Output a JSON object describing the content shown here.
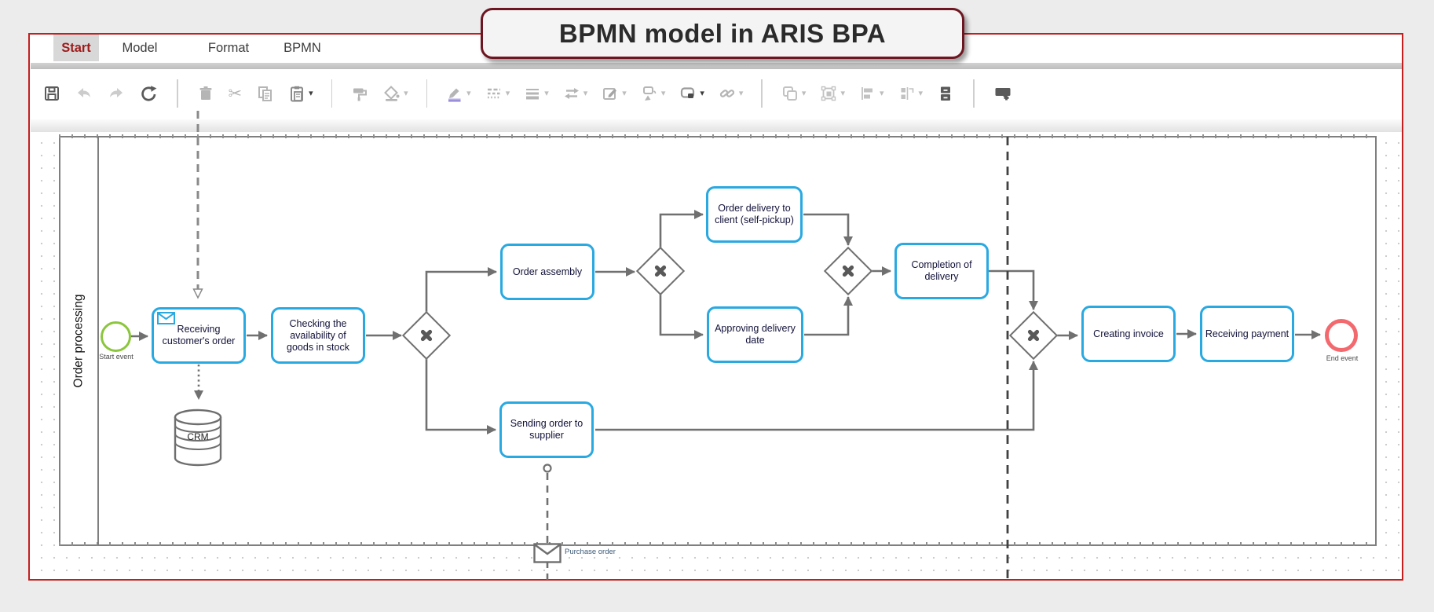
{
  "banner": {
    "title": "BPMN model in ARIS BPA"
  },
  "menu": {
    "items": [
      {
        "label": "Start",
        "active": true
      },
      {
        "label": "Model",
        "active": false
      },
      {
        "label": "Format",
        "active": false
      },
      {
        "label": "BPMN",
        "active": false
      }
    ]
  },
  "toolbar": {
    "buttons": [
      {
        "name": "save",
        "enabled": true,
        "dropdown": false
      },
      {
        "name": "undo",
        "enabled": false,
        "dropdown": false
      },
      {
        "name": "redo",
        "enabled": false,
        "dropdown": false
      },
      {
        "name": "refresh",
        "enabled": true,
        "dropdown": false
      },
      {
        "name": "delete",
        "enabled": false,
        "dropdown": false
      },
      {
        "name": "cut",
        "enabled": false,
        "dropdown": false
      },
      {
        "name": "copy",
        "enabled": false,
        "dropdown": false
      },
      {
        "name": "paste",
        "enabled": true,
        "dropdown": true
      },
      {
        "name": "format-painter",
        "enabled": false,
        "dropdown": false
      },
      {
        "name": "fill-color",
        "enabled": false,
        "dropdown": true
      },
      {
        "name": "pen-color",
        "enabled": false,
        "dropdown": true
      },
      {
        "name": "line-style",
        "enabled": false,
        "dropdown": true
      },
      {
        "name": "line-weight",
        "enabled": false,
        "dropdown": true
      },
      {
        "name": "arrow-style",
        "enabled": false,
        "dropdown": true
      },
      {
        "name": "edit-shape",
        "enabled": false,
        "dropdown": true
      },
      {
        "name": "connector",
        "enabled": false,
        "dropdown": true
      },
      {
        "name": "shape-style",
        "enabled": true,
        "dropdown": true
      },
      {
        "name": "link",
        "enabled": false,
        "dropdown": true
      },
      {
        "name": "group",
        "enabled": false,
        "dropdown": true
      },
      {
        "name": "frame",
        "enabled": false,
        "dropdown": true
      },
      {
        "name": "align",
        "enabled": false,
        "dropdown": true
      },
      {
        "name": "distribute",
        "enabled": false,
        "dropdown": true
      },
      {
        "name": "archive",
        "enabled": true,
        "dropdown": false
      },
      {
        "name": "add-comment",
        "enabled": true,
        "dropdown": false
      }
    ]
  },
  "diagram": {
    "pool": {
      "label": "Order processing"
    },
    "events": {
      "start": {
        "label": "Start event"
      },
      "end": {
        "label": "End event"
      }
    },
    "tasks": {
      "receiving": {
        "label": "Receiving customer's order"
      },
      "checking": {
        "label": "Checking the availability of goods in stock"
      },
      "assembly": {
        "label": "Order assembly"
      },
      "sending": {
        "label": "Sending order to supplier"
      },
      "delivery": {
        "label": "Order delivery to client (self-pickup)"
      },
      "approving": {
        "label": "Approving delivery date"
      },
      "completion": {
        "label": "Completion of delivery"
      },
      "invoice": {
        "label": "Creating invoice"
      },
      "payment": {
        "label": "Receiving payment"
      }
    },
    "gateways": {
      "type": "exclusive",
      "count": 4
    },
    "data_store": {
      "label": "CRM"
    },
    "message": {
      "label": "Purchase order"
    },
    "colors": {
      "task_border": "#2aa9e1",
      "start_event": "#8cc63e",
      "end_event": "#f2696e",
      "flow_line": "#707070",
      "panel_border": "#c41e1e",
      "banner_border": "#6d1520",
      "menu_active_text": "#9e1b1b"
    }
  }
}
